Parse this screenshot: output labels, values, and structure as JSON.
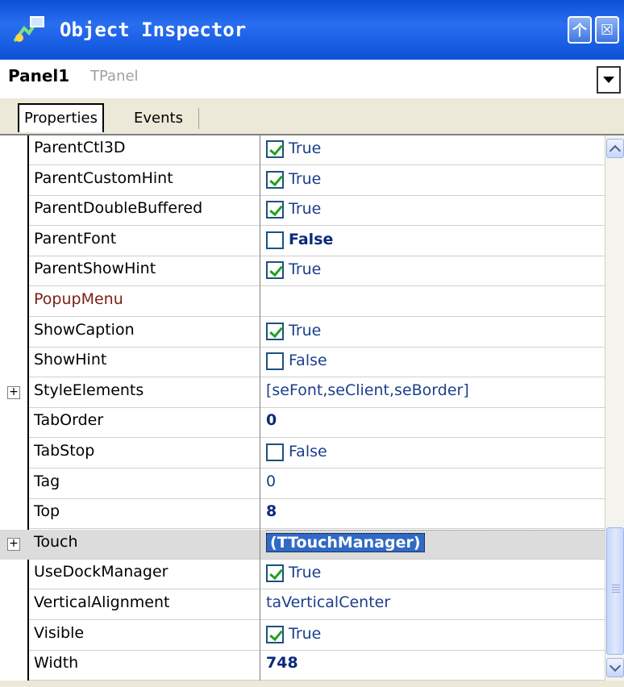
{
  "window": {
    "title": "Object Inspector",
    "pin_glyph": "个",
    "close_glyph": "☒"
  },
  "selector": {
    "name": "Panel1",
    "class": "TPanel"
  },
  "tabs": [
    {
      "label": "Properties"
    },
    {
      "label": "Events"
    }
  ],
  "selected_row_index": 13,
  "properties": [
    {
      "name": "ParentCtl3D",
      "value": "True",
      "kind": "check",
      "checked": true
    },
    {
      "name": "ParentCustomHint",
      "value": "True",
      "kind": "check",
      "checked": true
    },
    {
      "name": "ParentDoubleBuffered",
      "value": "True",
      "kind": "check",
      "checked": true
    },
    {
      "name": "ParentFont",
      "value": "False",
      "kind": "check",
      "checked": false,
      "bold": true
    },
    {
      "name": "ParentShowHint",
      "value": "True",
      "kind": "check",
      "checked": true
    },
    {
      "name": "PopupMenu",
      "value": "",
      "kind": "ref"
    },
    {
      "name": "ShowCaption",
      "value": "True",
      "kind": "check",
      "checked": true
    },
    {
      "name": "ShowHint",
      "value": "False",
      "kind": "check",
      "checked": false
    },
    {
      "name": "StyleElements",
      "value": "[seFont,seClient,seBorder]",
      "kind": "text",
      "expandable": true
    },
    {
      "name": "TabOrder",
      "value": "0",
      "kind": "text",
      "bold": true
    },
    {
      "name": "TabStop",
      "value": "False",
      "kind": "check",
      "checked": false
    },
    {
      "name": "Tag",
      "value": "0",
      "kind": "text"
    },
    {
      "name": "Top",
      "value": "8",
      "kind": "text",
      "bold": true
    },
    {
      "name": "Touch",
      "value": "(TTouchManager)",
      "kind": "text",
      "expandable": true,
      "selected": true
    },
    {
      "name": "UseDockManager",
      "value": "True",
      "kind": "check",
      "checked": true
    },
    {
      "name": "VerticalAlignment",
      "value": "taVerticalCenter",
      "kind": "text"
    },
    {
      "name": "Visible",
      "value": "True",
      "kind": "check",
      "checked": true
    },
    {
      "name": "Width",
      "value": "748",
      "kind": "text",
      "bold": true
    }
  ],
  "expander_glyph": "+",
  "colors": {
    "title_bar": "#0b52d8",
    "selection": "#316ac5",
    "value_text": "#1b3f8b",
    "ref_name": "#7a1f12"
  }
}
